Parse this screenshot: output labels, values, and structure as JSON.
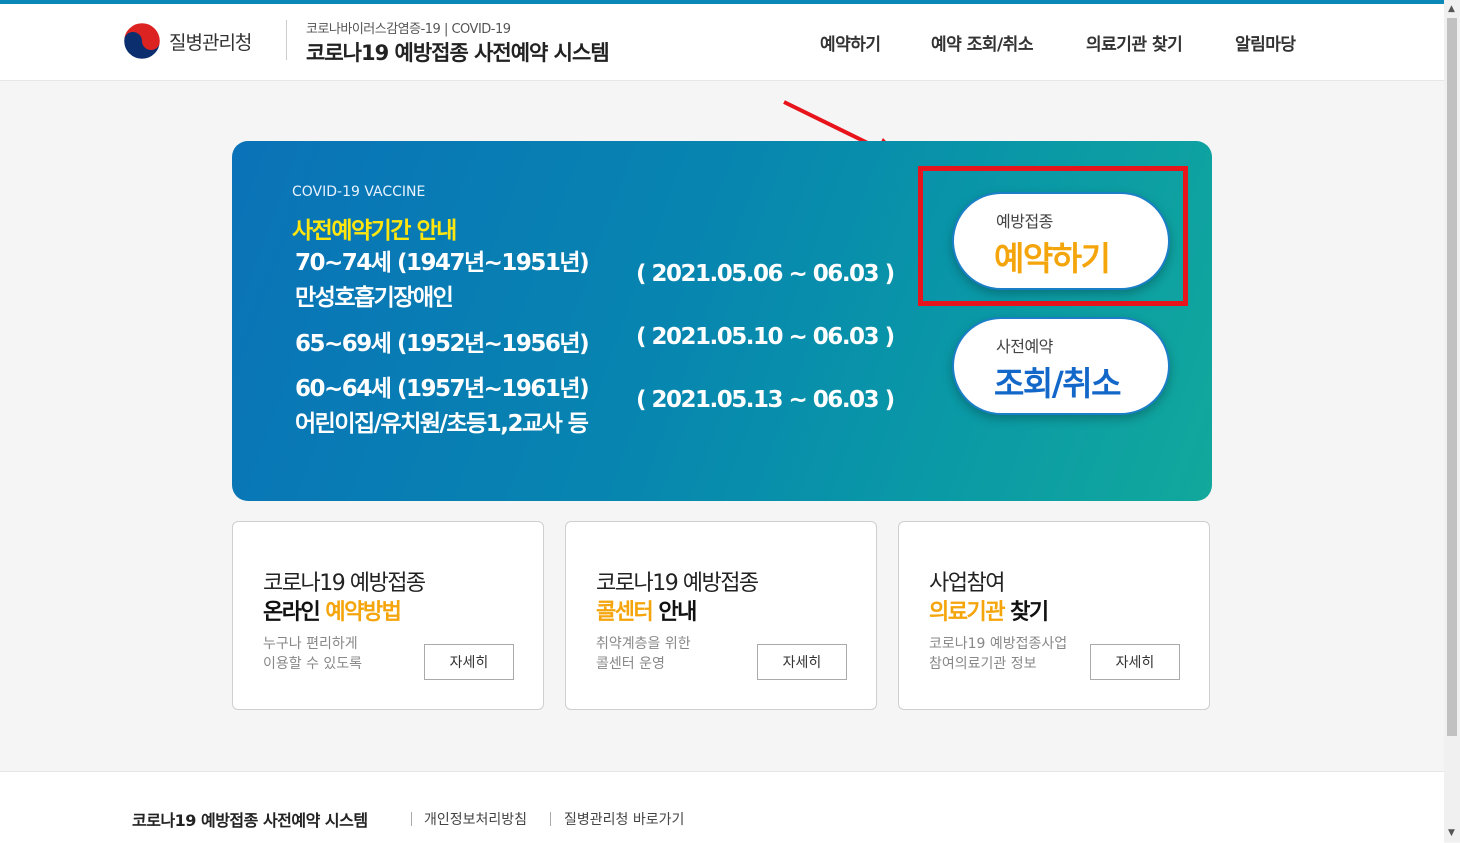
{
  "header": {
    "agency_name": "질병관리청",
    "subtitle": "코로나바이러스감염증-19 | COVID-19",
    "title": "코로나19 예방접종 사전예약 시스템"
  },
  "nav": [
    "예약하기",
    "예약 조회/취소",
    "의료기관 찾기",
    "알림마당"
  ],
  "banner": {
    "kicker": "COVID-19 VACCINE",
    "heading": "사전예약기간 안내",
    "rows": [
      {
        "line1": "70~74세 (1947년~1951년)",
        "line2": "만성호흡기장애인",
        "period": "( 2021.05.06 ~ 06.03 )"
      },
      {
        "line1": "65~69세 (1952년~1956년)",
        "period": "( 2021.05.10 ~ 06.03 )"
      },
      {
        "line1": "60~64세 (1957년~1961년)",
        "line2": "어린이집/유치원/초등1,2교사 등",
        "period": "( 2021.05.13 ~ 06.03 )"
      }
    ],
    "reserve_button": {
      "small": "예방접종",
      "big": "예약하기"
    },
    "lookup_button": {
      "small": "사전예약",
      "big": "조회/취소"
    }
  },
  "cards": [
    {
      "line1": "코로나19 예방접종",
      "line2a": "온라인 ",
      "line2b": "예약방법",
      "desc1": "누구나 편리하게",
      "desc2": "이용할 수 있도록",
      "button": "자세히"
    },
    {
      "line1": "코로나19 예방접종",
      "line2a": "콜센터",
      "line2b": " 안내",
      "desc1": "취약계층을 위한",
      "desc2": "콜센터 운영",
      "button": "자세히"
    },
    {
      "line1": "사업참여",
      "line2a": "의료기관",
      "line2b": " 찾기",
      "desc1": "코로나19 예방접종사업",
      "desc2": "참여의료기관 정보",
      "button": "자세히"
    }
  ],
  "footer": {
    "title": "코로나19 예방접종 사전예약 시스템",
    "links": [
      "개인정보처리방침",
      "질병관리청 바로가기"
    ]
  },
  "colors": {
    "accent_yellow": "#ffe60e",
    "accent_orange": "#f5a50c",
    "highlight_red": "#e8141c",
    "brand_blue": "#0a72b8"
  }
}
